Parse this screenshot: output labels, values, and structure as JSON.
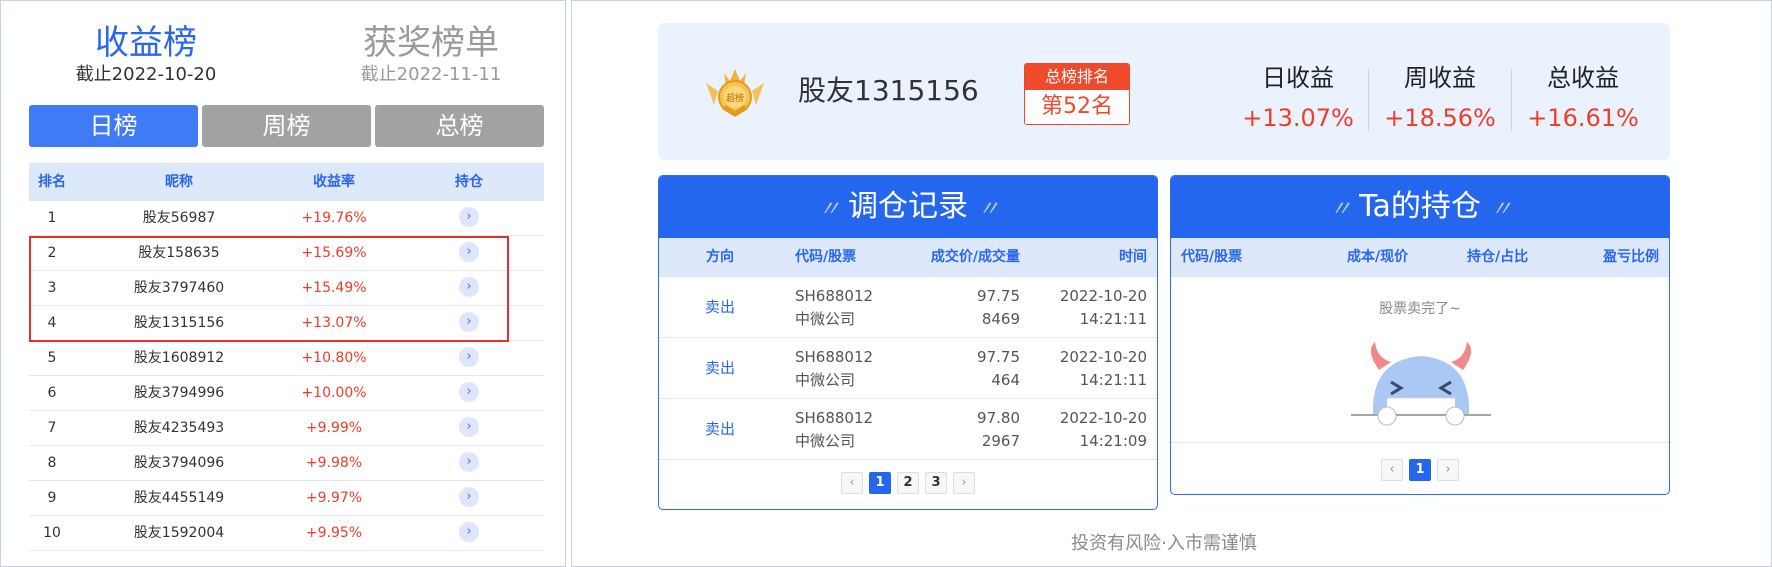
{
  "left": {
    "header1": {
      "title": "收益榜",
      "date": "截止2022-10-20"
    },
    "header2": {
      "title": "获奖榜单",
      "date": "截止2022-11-11"
    },
    "tabs": [
      "日榜",
      "周榜",
      "总榜"
    ],
    "columns": [
      "排名",
      "昵称",
      "收益率",
      "持仓"
    ],
    "rows": [
      {
        "rank": "1",
        "name": "股友56987",
        "rate": "+19.76%"
      },
      {
        "rank": "2",
        "name": "股友158635",
        "rate": "+15.69%"
      },
      {
        "rank": "3",
        "name": "股友3797460",
        "rate": "+15.49%"
      },
      {
        "rank": "4",
        "name": "股友1315156",
        "rate": "+13.07%"
      },
      {
        "rank": "5",
        "name": "股友1608912",
        "rate": "+10.80%"
      },
      {
        "rank": "6",
        "name": "股友3794996",
        "rate": "+10.00%"
      },
      {
        "rank": "7",
        "name": "股友4235493",
        "rate": "+9.99%"
      },
      {
        "rank": "8",
        "name": "股友3794096",
        "rate": "+9.98%"
      },
      {
        "rank": "9",
        "name": "股友4455149",
        "rate": "+9.97%"
      },
      {
        "rank": "10",
        "name": "股友1592004",
        "rate": "+9.95%"
      }
    ],
    "arrow_glyph": "›"
  },
  "profile": {
    "badge_text": "超榜",
    "username": "股友1315156",
    "rank_label": "总榜排名",
    "rank_value": "第52名",
    "stats": [
      {
        "label": "日收益",
        "value": "+13.07%"
      },
      {
        "label": "周收益",
        "value": "+18.56%"
      },
      {
        "label": "总收益",
        "value": "+16.61%"
      }
    ]
  },
  "trades": {
    "title": "调仓记录",
    "deco_left": "〃",
    "deco_right": "〃",
    "columns": [
      "方向",
      "代码/股票",
      "成交价/成交量",
      "时间"
    ],
    "rows": [
      {
        "direction": "卖出",
        "code": "SH688012",
        "stock": "中微公司",
        "price": "97.75",
        "qty": "8469",
        "date": "2022-10-20",
        "time": "14:21:11"
      },
      {
        "direction": "卖出",
        "code": "SH688012",
        "stock": "中微公司",
        "price": "97.75",
        "qty": "464",
        "date": "2022-10-20",
        "time": "14:21:11"
      },
      {
        "direction": "卖出",
        "code": "SH688012",
        "stock": "中微公司",
        "price": "97.80",
        "qty": "2967",
        "date": "2022-10-20",
        "time": "14:21:09"
      }
    ],
    "pager": {
      "prev": "‹",
      "pages": [
        "1",
        "2",
        "3"
      ],
      "next": "›"
    }
  },
  "holdings": {
    "title": "Ta的持仓",
    "deco_left": "〃",
    "deco_right": "〃",
    "columns": [
      "代码/股票",
      "成本/现价",
      "持仓/占比",
      "盈亏比例"
    ],
    "empty_text": "股票卖完了~",
    "pager": {
      "prev": "‹",
      "pages": [
        "1"
      ],
      "next": "›"
    }
  },
  "disclaimer": "投资有风险·入市需谨慎",
  "colors": {
    "accent": "#2566ef",
    "up": "#f03c28",
    "highlight": "#e53030"
  }
}
